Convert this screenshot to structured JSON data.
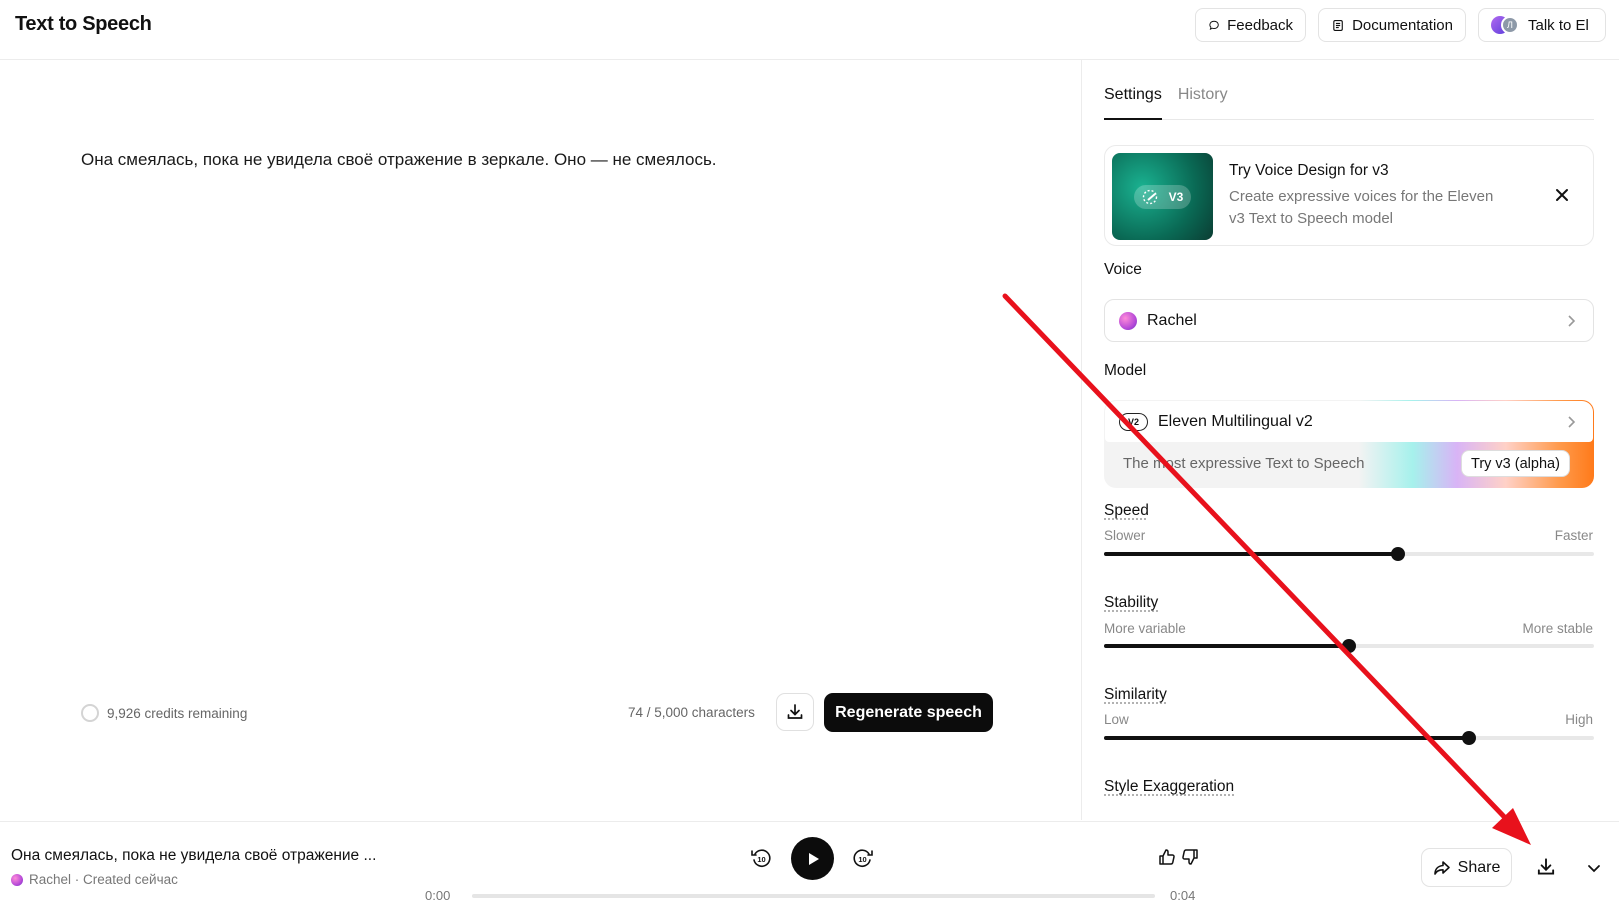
{
  "header": {
    "title": "Text to Speech",
    "feedback_label": "Feedback",
    "documentation_label": "Documentation",
    "talk_label": "Talk to El",
    "avatar_initial": "Л"
  },
  "editor": {
    "text": "Она смеялась, пока не увидела своё отражение в зеркале. Оно — не смеялось.",
    "credits": "9,926 credits remaining",
    "char_count": "74 / 5,000 characters",
    "regenerate_label": "Regenerate speech"
  },
  "panel": {
    "tabs": [
      {
        "label": "Settings",
        "active": true
      },
      {
        "label": "History",
        "active": false
      }
    ],
    "promo": {
      "badge": "V3",
      "title": "Try Voice Design for v3",
      "description": "Create expressive voices for the Eleven v3 Text to Speech model"
    },
    "voice": {
      "label": "Voice",
      "value": "Rachel"
    },
    "model": {
      "label": "Model",
      "badge": "V2",
      "value": "Eleven Multilingual v2",
      "subtitle": "The most expressive Text to Speech",
      "try_label": "Try v3 (alpha)"
    },
    "sliders": {
      "speed": {
        "title": "Speed",
        "low": "Slower",
        "high": "Faster",
        "value": 0.6
      },
      "stability": {
        "title": "Stability",
        "low": "More variable",
        "high": "More stable",
        "value": 0.5
      },
      "similarity": {
        "title": "Similarity",
        "low": "Low",
        "high": "High",
        "value": 0.745
      },
      "style": {
        "title": "Style Exaggeration"
      }
    }
  },
  "player": {
    "title": "Она смеялась, пока не увидела своё отражение ...",
    "meta": "Rachel · Created сейчас",
    "time_current": "0:00",
    "time_total": "0:04",
    "skip_back": "10",
    "skip_forward": "10",
    "share_label": "Share"
  },
  "colors": {
    "annotation_arrow": "#e8111c",
    "primary_button": "#0c0c0c"
  }
}
